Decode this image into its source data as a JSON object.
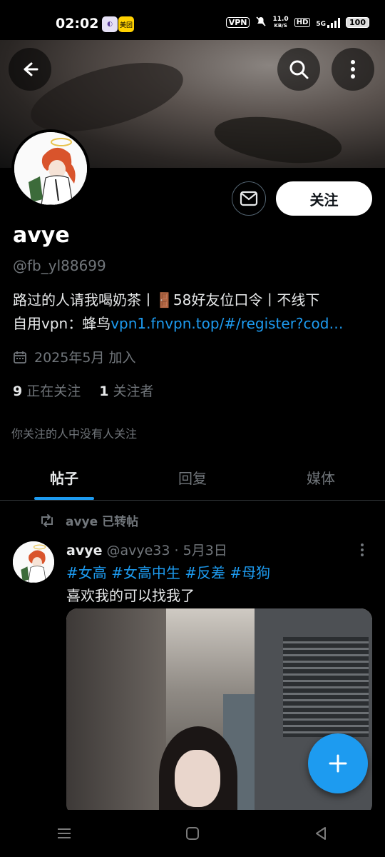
{
  "status_bar": {
    "time": "02:02",
    "app_icon_2": "美团",
    "vpn": "VPN",
    "speed_value": "11.0",
    "speed_unit": "KB/S",
    "hd": "HD",
    "network": "5G",
    "battery": "100"
  },
  "profile": {
    "name": "avye",
    "handle": "@fb_yl88699",
    "bio_line1": "路过的人请我喝奶茶丨🚪58好友位口令丨不线下",
    "bio_line2_prefix": "自用vpn：蜂鸟",
    "bio_link": "vpn1.fnvpn.top/#/register?cod…",
    "joined": "2025年5月 加入",
    "following_count": "9",
    "following_label": "正在关注",
    "followers_count": "1",
    "followers_label": "关注者",
    "no_common": "你关注的人中没有人关注",
    "follow_button": "关注"
  },
  "tabs": [
    {
      "label": "帖子",
      "active": true
    },
    {
      "label": "回复",
      "active": false
    },
    {
      "label": "媒体",
      "active": false
    }
  ],
  "post": {
    "repost_label": "avye 已转帖",
    "author": "avye",
    "meta": "@avye33 · 5月3日",
    "tags": "#女高 #女高中生 #反差 #母狗",
    "text": "喜欢我的可以找我了"
  },
  "colors": {
    "accent": "#1d9bf0",
    "background": "#000000",
    "text_secondary": "#71767b"
  },
  "icons": {
    "back": "back-arrow-icon",
    "search": "search-icon",
    "more": "more-vertical-icon",
    "message": "mail-icon",
    "calendar": "calendar-icon",
    "repost": "repost-icon",
    "compose": "plus-icon"
  }
}
